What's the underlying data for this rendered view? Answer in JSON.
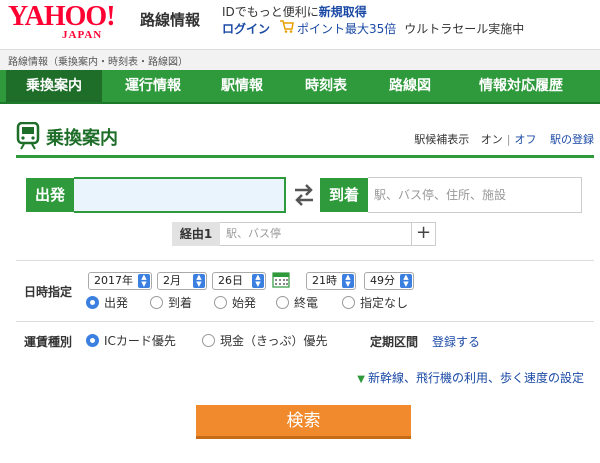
{
  "header": {
    "logo_main": "YAHOO!",
    "logo_sub": "JAPAN",
    "service": "路線情報",
    "promo_text": "IDでもっと便利に",
    "promo_link": "新規取得",
    "login": "ログイン",
    "points": "ポイント最大35倍",
    "sale": "ウルトラセール実施中"
  },
  "breadcrumb": "路線情報（乗換案内・時刻表・路線図）",
  "nav": {
    "items": [
      "乗換案内",
      "運行情報",
      "駅情報",
      "時刻表",
      "路線図",
      "情報対応履歴"
    ]
  },
  "section": {
    "title": "乗換案内",
    "suggest_label": "駅候補表示",
    "on": "オン",
    "off": "オフ",
    "register": "駅の登録"
  },
  "route": {
    "from_label": "出発",
    "from_value": "",
    "to_label": "到着",
    "to_placeholder": "駅、バス停、住所、施設",
    "via_label": "経由1",
    "via_placeholder": "駅、バス停",
    "via_add": "+"
  },
  "datetime": {
    "label": "日時指定",
    "year": "2017年",
    "month": "2月",
    "day": "26日",
    "hour": "21時",
    "minute": "49分",
    "options": [
      "出発",
      "到着",
      "始発",
      "終電",
      "指定なし"
    ],
    "selected": "出発"
  },
  "fare": {
    "label": "運賃種別",
    "options": [
      "ICカード優先",
      "現金（きっぷ）優先"
    ],
    "selected": "ICカード優先",
    "commuter_label": "定期区間",
    "commuter_link": "登録する"
  },
  "advanced_link": "新幹線、飛行機の利用、歩く速度の設定",
  "search_button": "検索",
  "colors": {
    "brand_green": "#2f9a3c",
    "nav_active": "#1e6d28",
    "search_orange": "#f08a2c",
    "link_blue": "#1b4aa5",
    "yahoo_red": "#ff0033"
  }
}
